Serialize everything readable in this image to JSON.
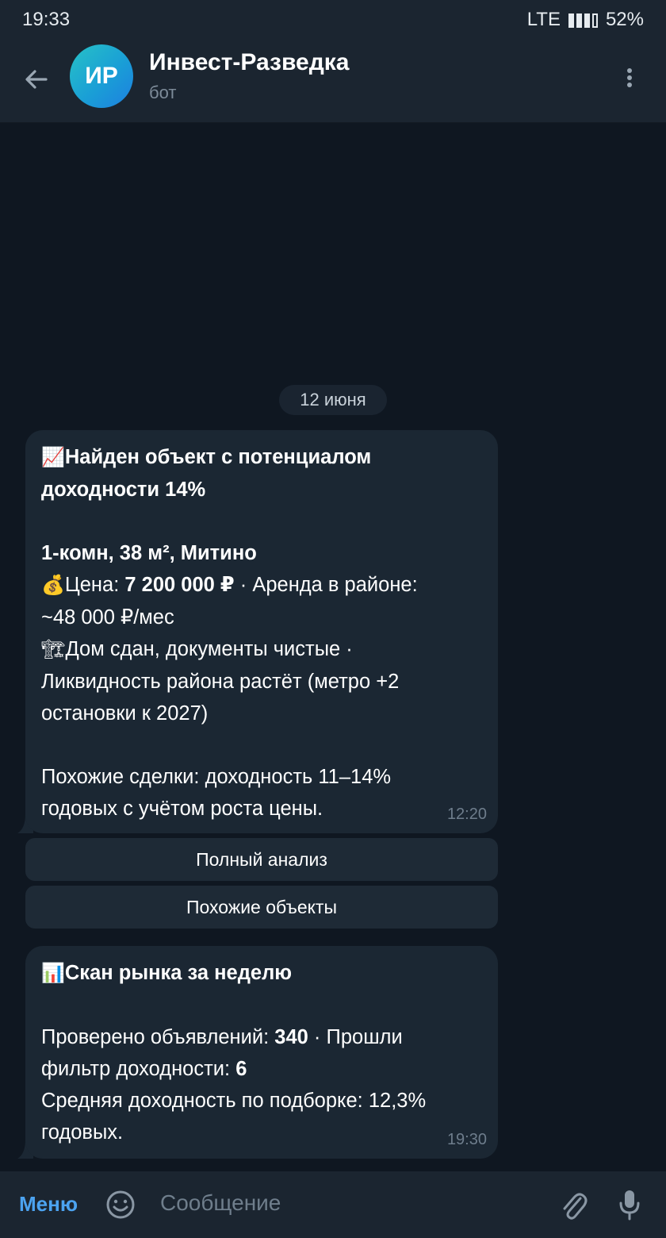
{
  "status_bar": {
    "time": "19:33",
    "network": "LTE",
    "battery": "52%"
  },
  "header": {
    "avatar_initials": "ИР",
    "title": "Инвест-Разведка",
    "subtitle": "бот"
  },
  "date_separator": "12 июня",
  "messages": [
    {
      "time": "12:20",
      "lines": [
        {
          "icon": "chart-up-icon",
          "parts": [
            {
              "t": "Найден объект с потенциалом",
              "b": true
            }
          ]
        },
        {
          "parts": [
            {
              "t": "доходности 14%",
              "b": true
            }
          ]
        },
        {
          "parts": []
        },
        {
          "parts": [
            {
              "t": "1-комн, 38 м², Митино",
              "b": true
            }
          ]
        },
        {
          "icon": "money-bag-icon",
          "parts": [
            {
              "t": "Цена: ",
              "b": false
            },
            {
              "t": "7 200 000 ₽",
              "b": true
            },
            {
              "t": " · Аренда в районе:",
              "b": false
            }
          ]
        },
        {
          "parts": [
            {
              "t": "~48 000 ₽/мес",
              "b": false
            }
          ]
        },
        {
          "icon": "construction-crane-icon",
          "parts": [
            {
              "t": "Дом сдан, документы чистые ·",
              "b": false
            }
          ]
        },
        {
          "parts": [
            {
              "t": "Ликвидность района растёт (метро +2",
              "b": false
            }
          ]
        },
        {
          "parts": [
            {
              "t": "остановки к 2027)",
              "b": false
            }
          ]
        },
        {
          "parts": []
        },
        {
          "parts": [
            {
              "t": "Похожие сделки: доходность 11–14%",
              "b": false
            }
          ]
        },
        {
          "parts": [
            {
              "t": "годовых с учётом роста цены.",
              "b": false
            }
          ]
        }
      ]
    },
    {
      "time": "19:30",
      "lines": [
        {
          "icon": "bar-chart-icon",
          "parts": [
            {
              "t": "Скан рынка за неделю",
              "b": true
            }
          ]
        },
        {
          "parts": []
        },
        {
          "parts": [
            {
              "t": "Проверено объявлений: ",
              "b": false
            },
            {
              "t": "340",
              "b": true
            },
            {
              "t": " · Прошли",
              "b": false
            }
          ]
        },
        {
          "parts": [
            {
              "t": "фильтр доходности: ",
              "b": false
            },
            {
              "t": "6",
              "b": true
            }
          ]
        },
        {
          "parts": [
            {
              "t": "Средняя доходность по подборке: 12,3%",
              "b": false
            }
          ]
        },
        {
          "parts": [
            {
              "t": "годовых.",
              "b": false
            }
          ]
        }
      ]
    }
  ],
  "inline_buttons": [
    "Полный анализ",
    "Похожие объекты"
  ],
  "composer": {
    "menu_label": "Меню",
    "placeholder": "Сообщение"
  },
  "colors": {
    "background": "#0f1721",
    "bubble": "#1b2733",
    "bar": "#1b2530",
    "accent": "#4ca3f0",
    "muted": "#6e7d8c"
  }
}
